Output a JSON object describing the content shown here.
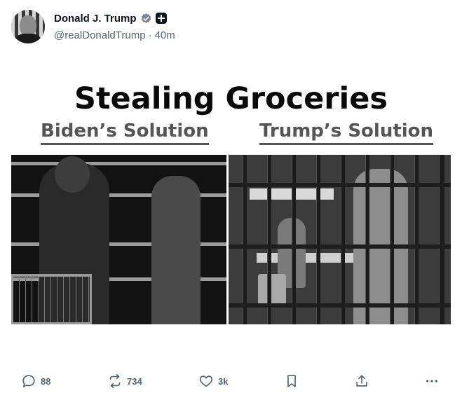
{
  "post": {
    "author": {
      "display_name": "Donald J. Trump",
      "handle": "@realDonaldTrump",
      "separator": "·",
      "time": "40m",
      "verified_icon": "verified-badge-icon",
      "extra_badge_icon": "plus-badge-icon"
    },
    "image": {
      "title": "Stealing Groceries",
      "left_caption": "Biden’s Solution",
      "right_caption": "Trump’s Solution"
    },
    "actions": {
      "replies": "88",
      "reposts": "734",
      "likes": "3k"
    }
  },
  "colors": {
    "text_primary": "#0f1419",
    "text_secondary": "#536471",
    "background": "#ffffff"
  }
}
